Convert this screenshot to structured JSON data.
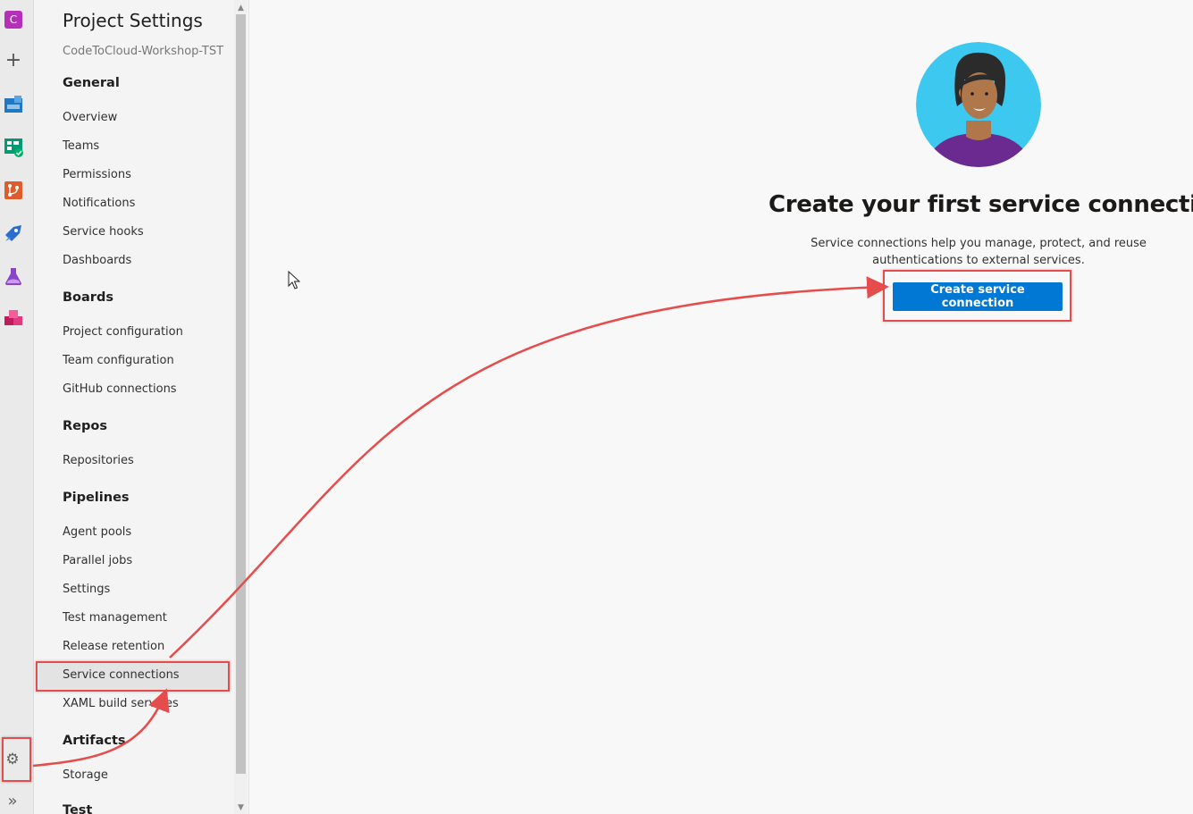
{
  "rail": {
    "org_initial": "C",
    "icons": [
      "plus-icon",
      "overview-icon",
      "boards-icon",
      "repos-icon",
      "pipelines-icon",
      "test-plans-icon",
      "artifacts-icon",
      "settings-gear-icon",
      "expand-chevrons-icon"
    ]
  },
  "sidebar": {
    "title": "Project Settings",
    "project": "CodeToCloud-Workshop-TST",
    "sections": {
      "general": {
        "label": "General",
        "items": [
          "Overview",
          "Teams",
          "Permissions",
          "Notifications",
          "Service hooks",
          "Dashboards"
        ]
      },
      "boards": {
        "label": "Boards",
        "items": [
          "Project configuration",
          "Team configuration",
          "GitHub connections"
        ]
      },
      "repos": {
        "label": "Repos",
        "items": [
          "Repositories"
        ]
      },
      "pipelines": {
        "label": "Pipelines",
        "items": [
          "Agent pools",
          "Parallel jobs",
          "Settings",
          "Test management",
          "Release retention",
          "Service connections",
          "XAML build services"
        ]
      },
      "artifacts": {
        "label": "Artifacts",
        "items": [
          "Storage"
        ]
      },
      "test": {
        "label": "Test"
      }
    },
    "selected_item": "Service connections"
  },
  "main": {
    "heading": "Create your first service connection",
    "description": "Service connections help you manage, protect, and reuse authentications to external services.",
    "cta_label": "Create service connection"
  },
  "colors": {
    "accent": "#0078d4",
    "annotation": "#e74c4c",
    "avatar_bg": "#3cc8ef"
  }
}
